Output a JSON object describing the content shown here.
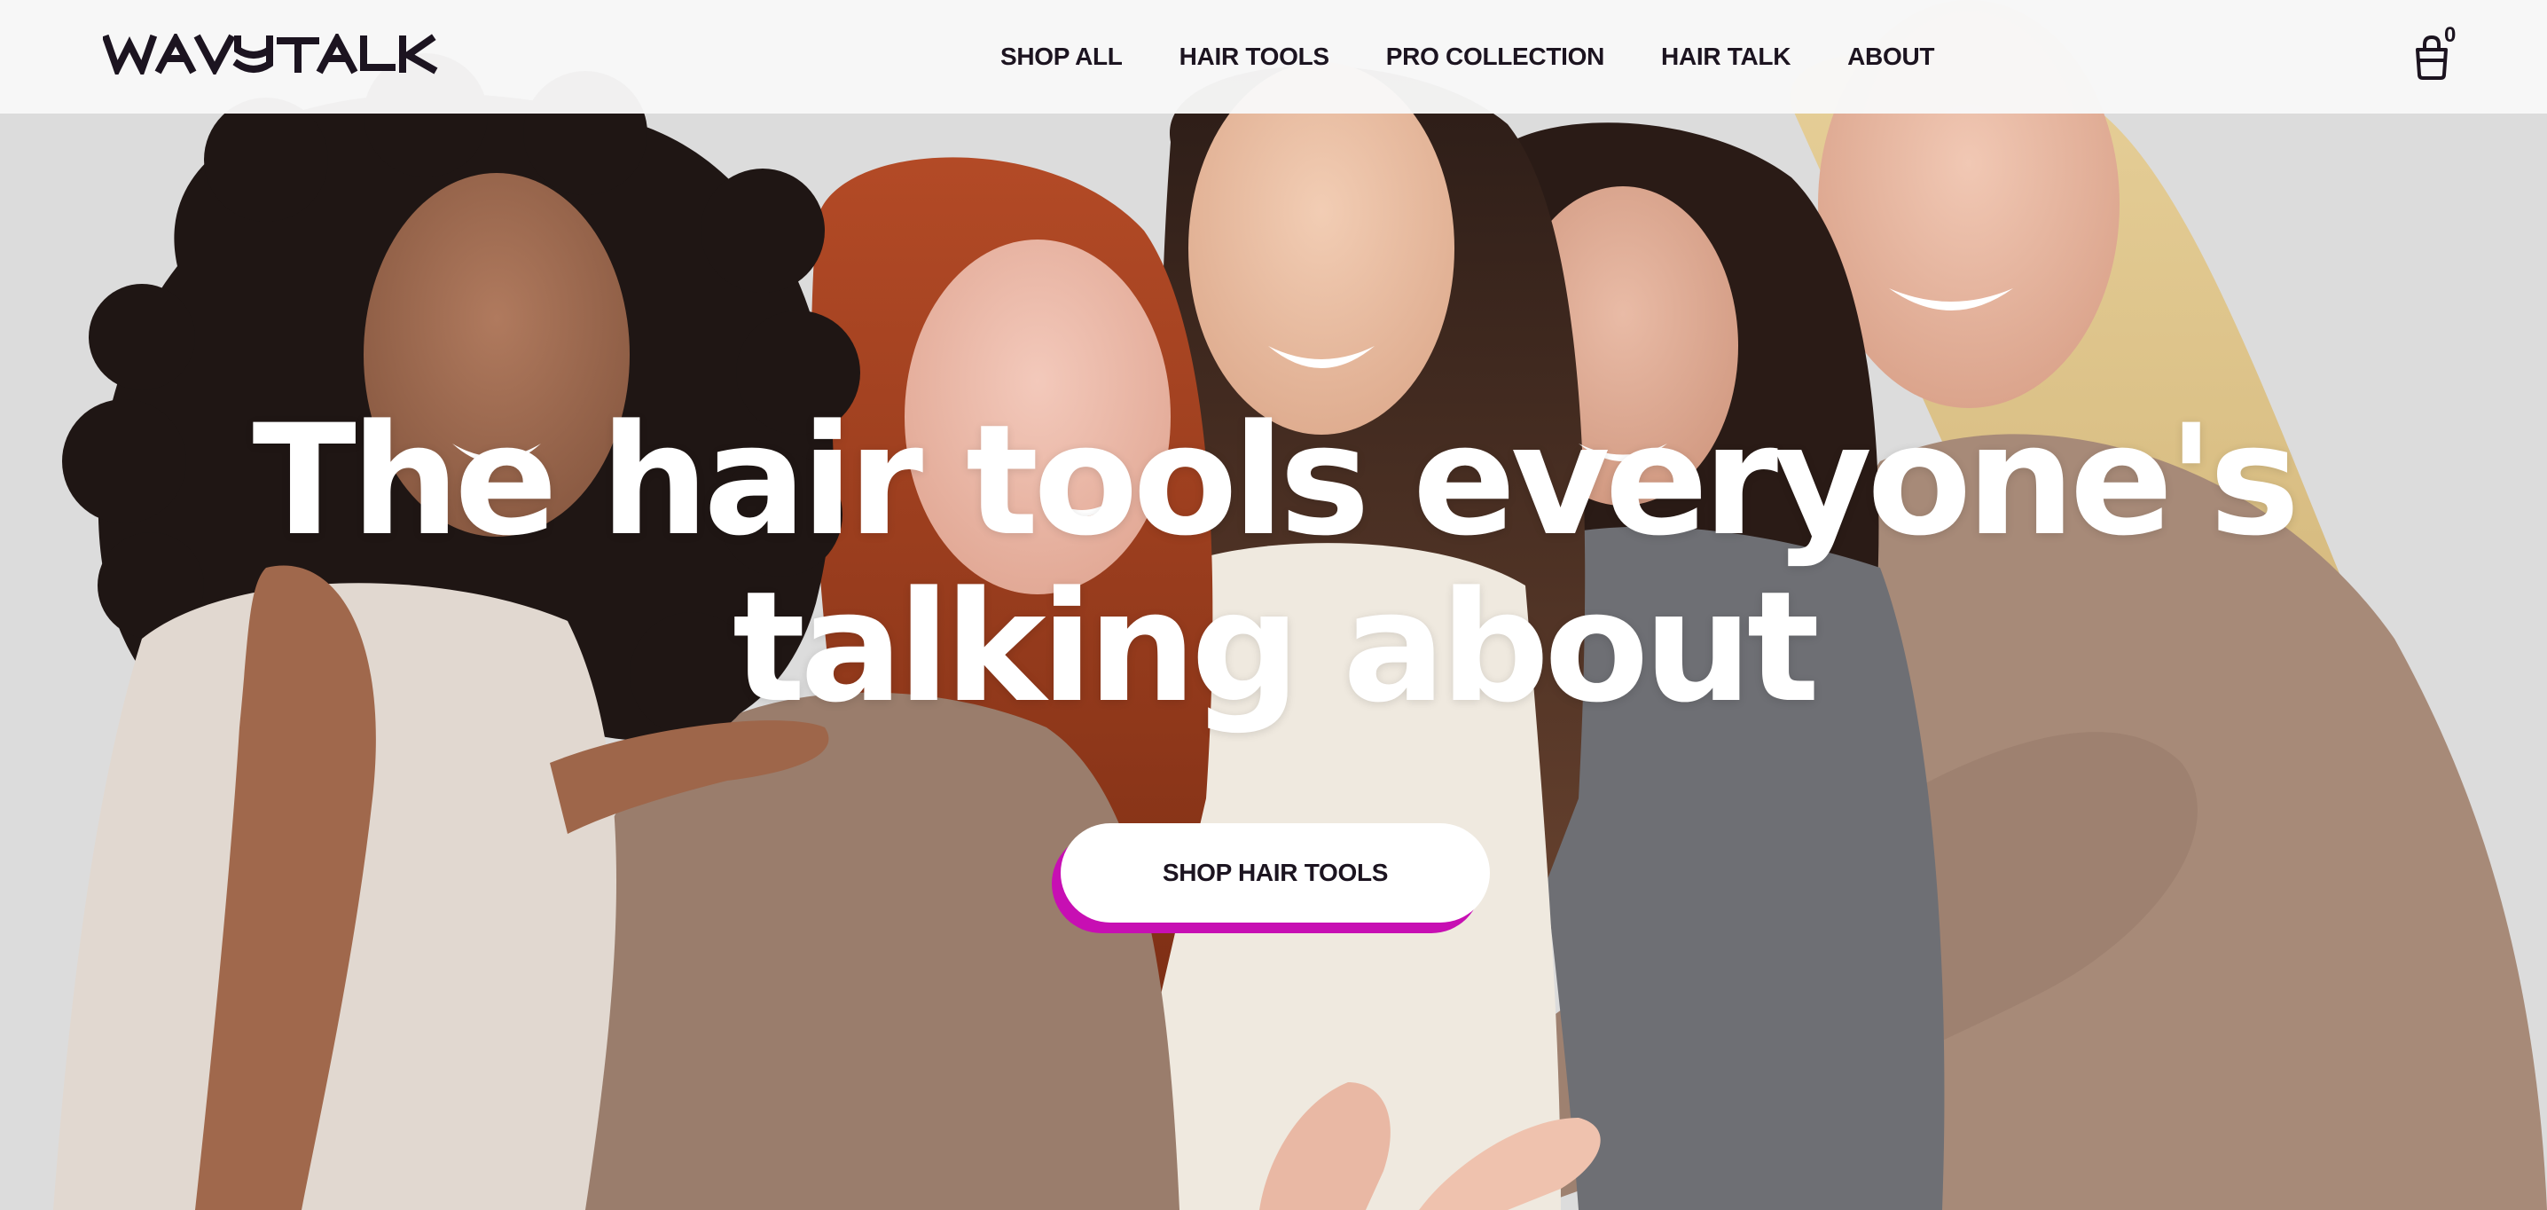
{
  "brand": {
    "logo_text": "WAVYTALK"
  },
  "nav": {
    "items": [
      {
        "label": "SHOP ALL"
      },
      {
        "label": "HAIR TOOLS"
      },
      {
        "label": "PRO COLLECTION"
      },
      {
        "label": "HAIR TALK"
      },
      {
        "label": "ABOUT"
      }
    ]
  },
  "cart": {
    "icon": "shopping-bag-icon",
    "count": "0"
  },
  "hero": {
    "headline_line1": "The hair tools everyone's",
    "headline_line2": "talking about",
    "cta_label": "SHOP HAIR TOOLS",
    "image_alt": "five smiling women hugging"
  },
  "colors": {
    "header_bg": "#f8f8f8",
    "text_dark": "#1c1420",
    "cta_accent": "#c70fb3",
    "headline": "#ffffff"
  }
}
